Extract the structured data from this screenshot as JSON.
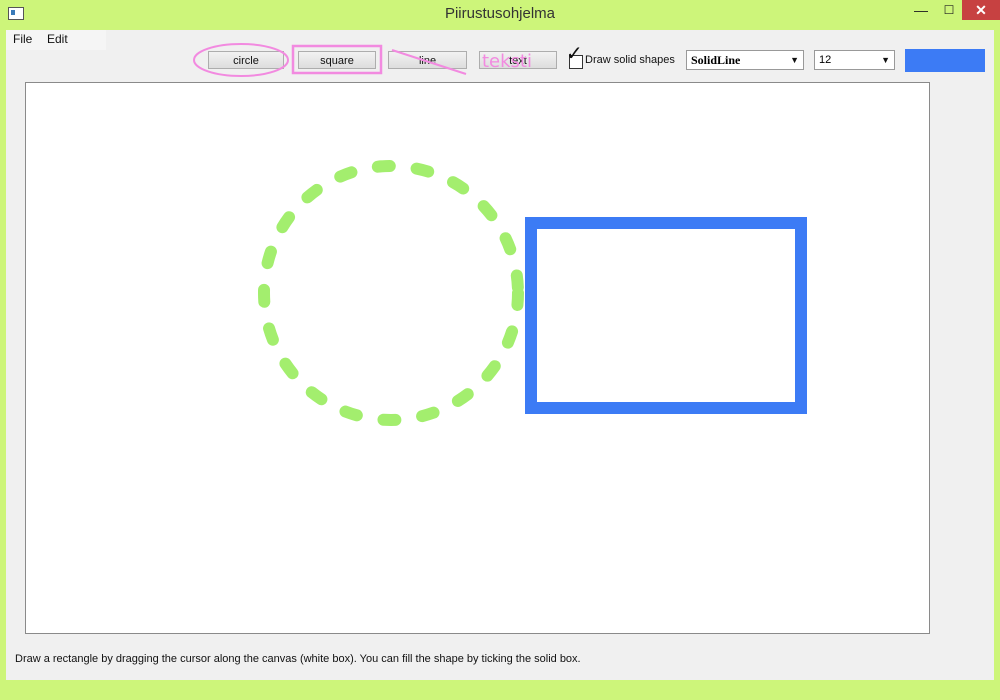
{
  "window": {
    "title": "Piirustusohjelma",
    "min_glyph": "—",
    "max_glyph": "☐",
    "close_glyph": "✕"
  },
  "menu": {
    "file": "File",
    "edit": "Edit"
  },
  "toolbar": {
    "circle_label": "circle",
    "square_label": "square",
    "line_label": "line",
    "text_label": "text",
    "text_annotation": "teksti",
    "solid_checkbox_label": "Draw solid shapes",
    "solid_checked": true,
    "line_style_value": "SolidLine",
    "size_value": "12",
    "color_value": "#3c7bf5"
  },
  "canvas": {
    "shapes": [
      {
        "type": "circle",
        "style": "dashed",
        "color": "#a3ee6e"
      },
      {
        "type": "square",
        "style": "solid",
        "color": "#3c7bf5"
      }
    ]
  },
  "annotation_color": "#f28ae0",
  "status_text": "Draw a rectangle by dragging the cursor along the canvas (white box). You can fill the shape by ticking the solid box."
}
